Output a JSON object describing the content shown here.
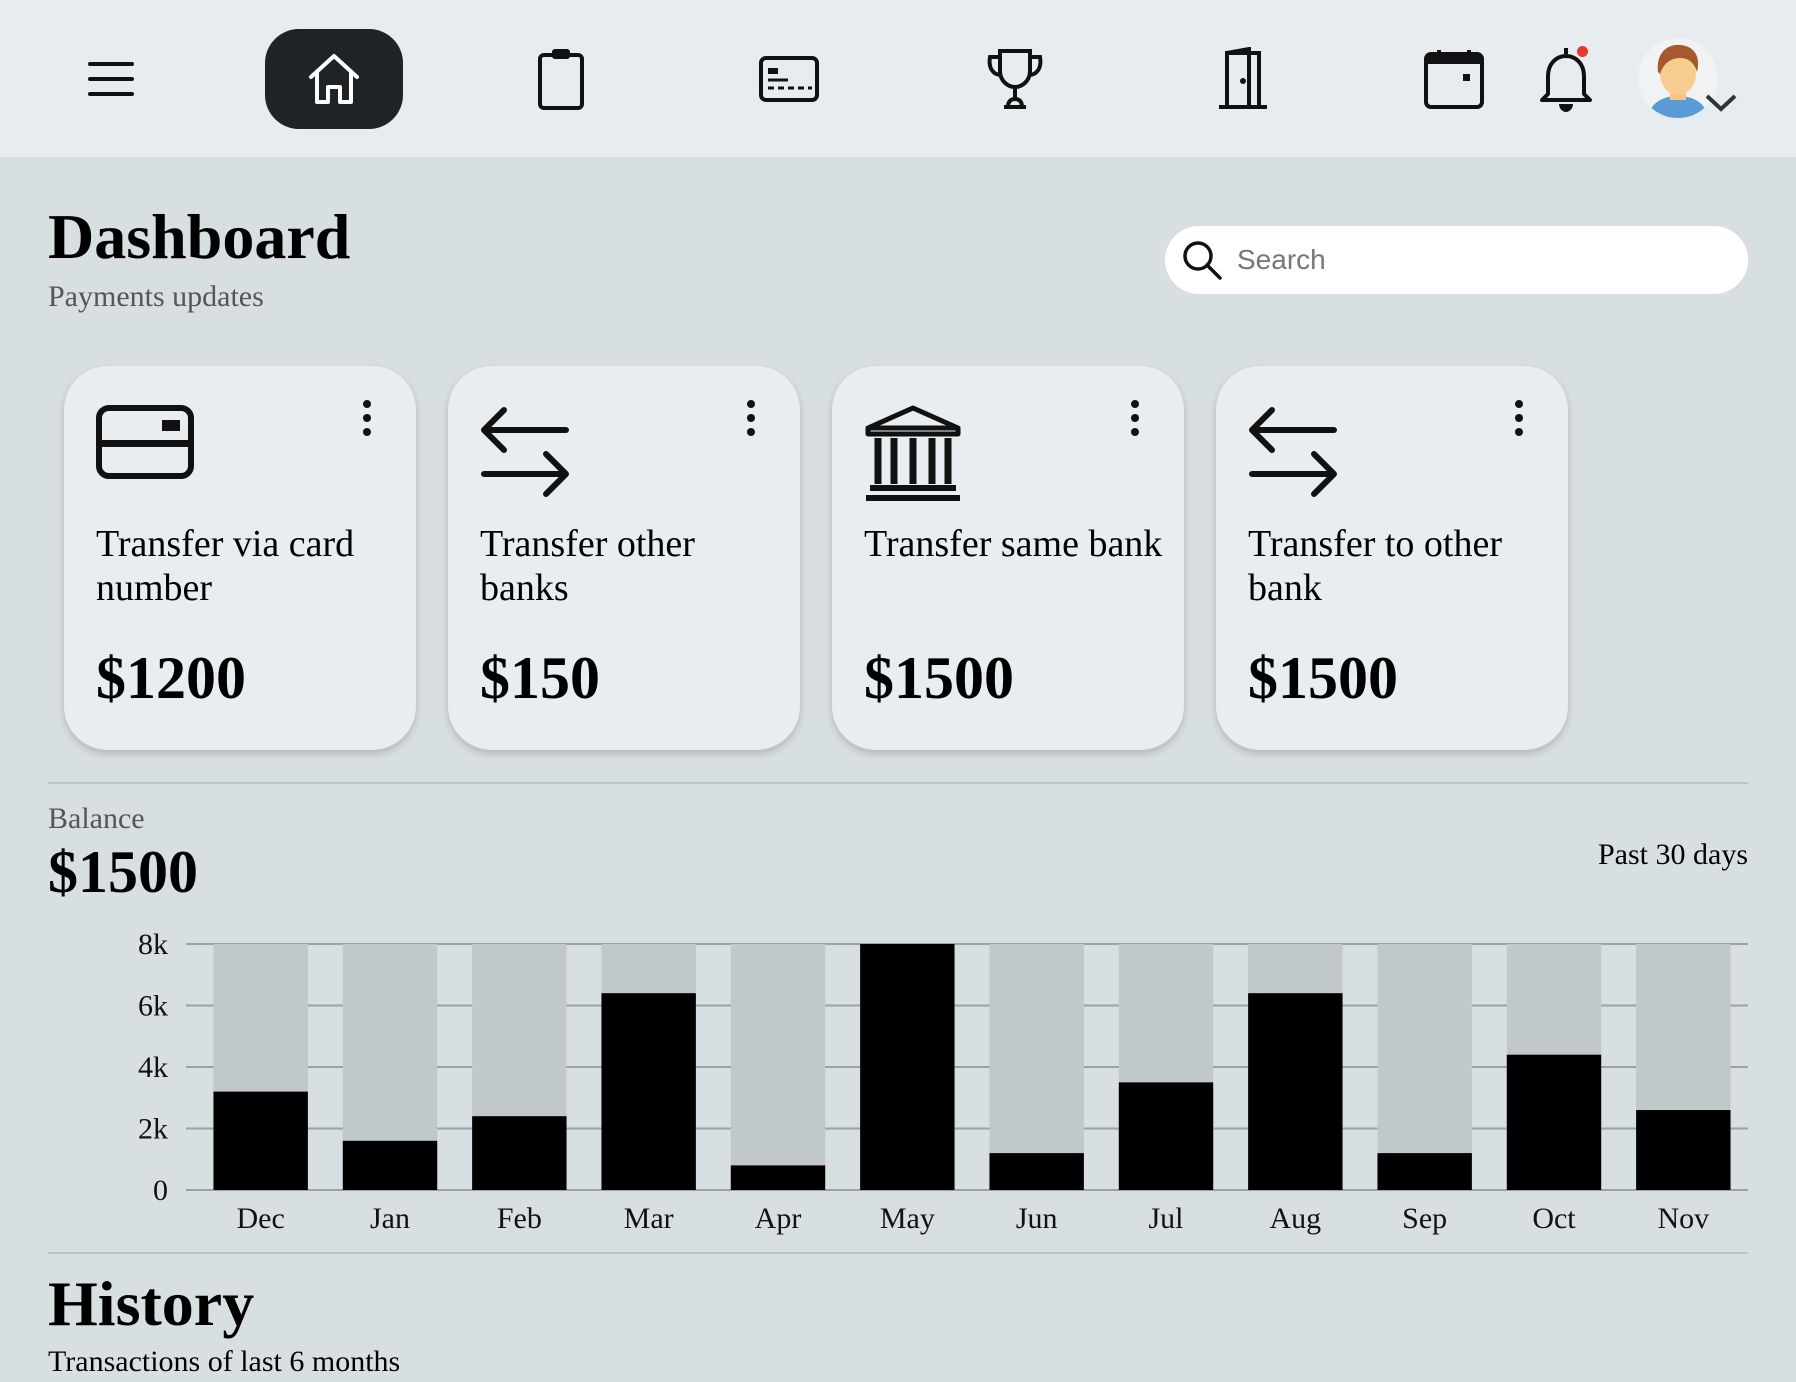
{
  "nav": {
    "items": [
      {
        "name": "home",
        "icon": "home-icon",
        "active": true
      },
      {
        "name": "clipboard",
        "icon": "clipboard-icon",
        "active": false
      },
      {
        "name": "cards",
        "icon": "id-card-icon",
        "active": false
      },
      {
        "name": "awards",
        "icon": "trophy-icon",
        "active": false
      },
      {
        "name": "logout",
        "icon": "door-icon",
        "active": false
      }
    ],
    "right": [
      "calendar-icon",
      "bell-icon",
      "avatar"
    ],
    "notification_dot_color": "#e53a2a",
    "active_bg_color": "#1f2326"
  },
  "header": {
    "title": "Dashboard",
    "subtitle": "Payments updates"
  },
  "search": {
    "placeholder": "Search"
  },
  "cards": [
    {
      "icon": "credit-card-icon",
      "label": "Transfer via card number",
      "amount": "$1200"
    },
    {
      "icon": "transfer-arrows-icon",
      "label": "Transfer other banks",
      "amount": "$150"
    },
    {
      "icon": "bank-icon",
      "label": "Transfer same bank",
      "amount": "$1500"
    },
    {
      "icon": "transfer-arrows-icon",
      "label": "Transfer to other bank",
      "amount": "$1500"
    }
  ],
  "balance": {
    "label": "Balance",
    "value": "$1500",
    "period": "Past 30 days"
  },
  "chart_data": {
    "type": "bar",
    "categories": [
      "Dec",
      "Jan",
      "Feb",
      "Mar",
      "Apr",
      "May",
      "Jun",
      "Jul",
      "Aug",
      "Sep",
      "Oct",
      "Nov"
    ],
    "values": [
      3200,
      1600,
      2400,
      6400,
      800,
      8000,
      1200,
      3500,
      6400,
      1200,
      4400,
      2600
    ],
    "ylim": [
      0,
      8000
    ],
    "yticks": [
      "0",
      "2k",
      "4k",
      "6k",
      "8k"
    ],
    "colors": {
      "bar": "#000000",
      "track": "#c1c8cb",
      "grid": "#9aa2a6"
    }
  },
  "history": {
    "title": "History",
    "subtitle": "Transactions of last 6 months"
  }
}
